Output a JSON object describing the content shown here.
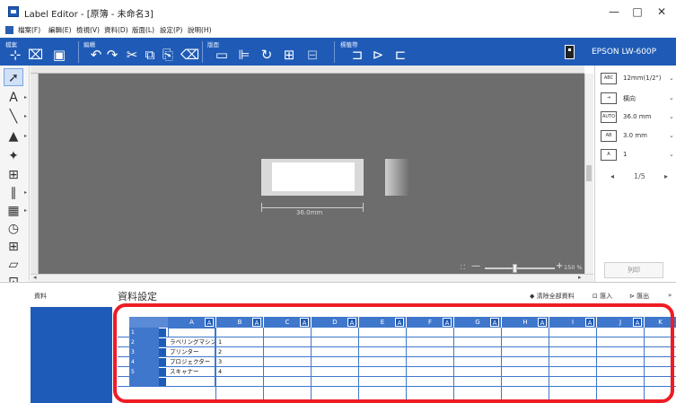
{
  "window": {
    "title": "Label Editor - [原簿 - 未命名3]",
    "minimize": "—",
    "maximize": "□",
    "close": "✕"
  },
  "menu": [
    "檔案(F)",
    "編輯(E)",
    "檢視(V)",
    "資料(D)",
    "版面(L)",
    "設定(P)",
    "說明(H)"
  ],
  "ribbon": {
    "groups": [
      "檔案",
      "編輯",
      "版面",
      "標籤帶"
    ],
    "printer": "EPSON LW-600P"
  },
  "properties": {
    "tape_width": "12mm(1/2\")",
    "orientation": "橫向",
    "length": "36.0 mm",
    "margin": "3.0 mm",
    "copies": "1",
    "page": "1/5",
    "print_button": "列印"
  },
  "canvas": {
    "dimension_label": "36.0mm",
    "zoom": "150 %"
  },
  "data_panel": {
    "sidebar_label": "資料",
    "title": "資料設定",
    "clear_all": "清除全部資料",
    "import": "匯入",
    "export": "匯出",
    "columns": [
      "A",
      "B",
      "C",
      "D",
      "E",
      "F",
      "G",
      "H",
      "I",
      "J",
      "K"
    ],
    "column_badge": "A",
    "rows": [
      {
        "num": "1",
        "a": "",
        "b": ""
      },
      {
        "num": "2",
        "a": "ラベリングマシン",
        "b": "1"
      },
      {
        "num": "3",
        "a": "プリンター",
        "b": "2"
      },
      {
        "num": "4",
        "a": "プロジェクター",
        "b": "3"
      },
      {
        "num": "5",
        "a": "スキャナー",
        "b": "4"
      },
      {
        "num": "",
        "a": "",
        "b": ""
      }
    ]
  }
}
